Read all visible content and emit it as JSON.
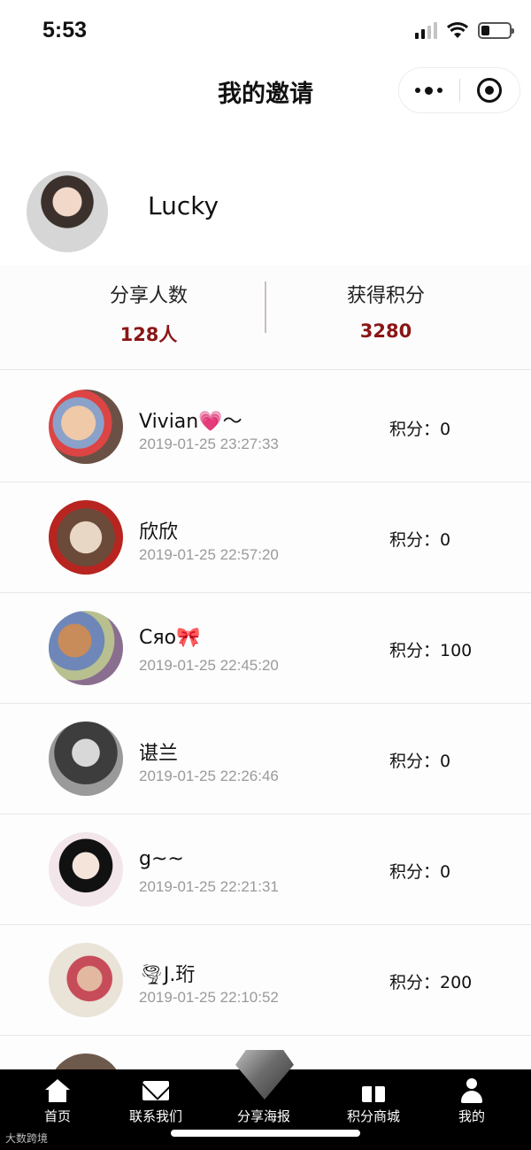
{
  "status_bar": {
    "time": "5:53",
    "battery_level": 0.3
  },
  "nav": {
    "title": "我的邀请"
  },
  "profile": {
    "name": "Lucky"
  },
  "stats": {
    "share_label": "分享人数",
    "share_value": "128人",
    "points_label": "获得积分",
    "points_value": "3280",
    "accent_color": "#8b1616"
  },
  "invites": [
    {
      "name": "Vivian💗～",
      "date": "2019-01-25 23:27:33",
      "points": "积分：0"
    },
    {
      "name": "欣欣",
      "date": "2019-01-25 22:57:20",
      "points": "积分：0"
    },
    {
      "name": "Cяо🎀",
      "date": "2019-01-25 22:45:20",
      "points": "积分：100"
    },
    {
      "name": "谌兰",
      "date": "2019-01-25 22:26:46",
      "points": "积分：0"
    },
    {
      "name": "g~~",
      "date": "2019-01-25 22:21:31",
      "points": "积分：0"
    },
    {
      "name": "🌪J.珩",
      "date": "2019-01-25 22:10:52",
      "points": "积分：200"
    }
  ],
  "tabs": [
    {
      "label": "首页",
      "icon": "home-icon"
    },
    {
      "label": "联系我们",
      "icon": "mail-icon"
    },
    {
      "label": "分享海报",
      "icon": "diamond-icon"
    },
    {
      "label": "积分商城",
      "icon": "gift-icon"
    },
    {
      "label": "我的",
      "icon": "person-icon"
    }
  ],
  "watermark": "大数跨境"
}
